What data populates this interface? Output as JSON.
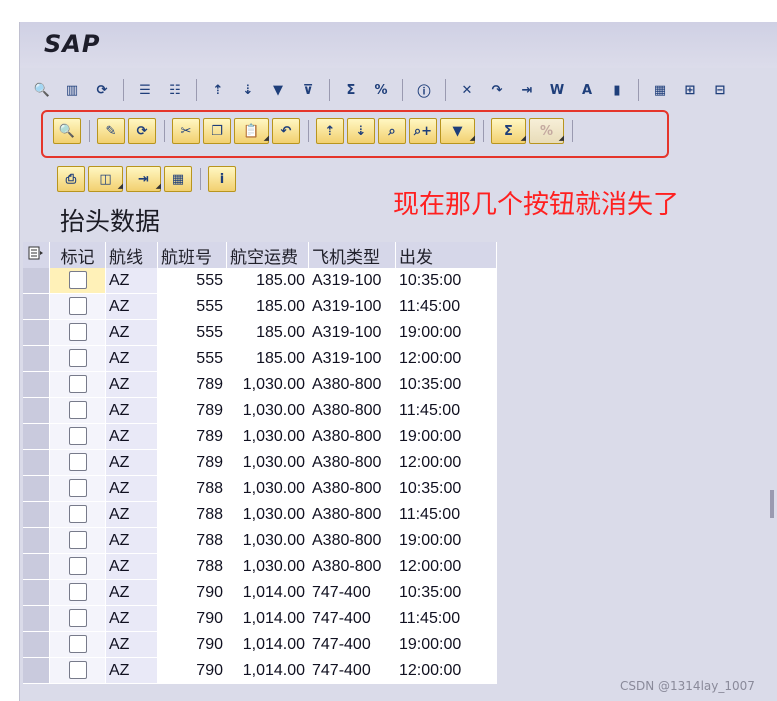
{
  "app": {
    "title": "SAP"
  },
  "toolbar_main": {
    "buttons": [
      {
        "icon": "detail-icon",
        "glyph": "🔍"
      },
      {
        "icon": "columns-icon",
        "glyph": "▥"
      },
      {
        "icon": "refresh-icon",
        "glyph": "⟳"
      },
      {
        "icon": "select-all-icon",
        "glyph": "☰"
      },
      {
        "icon": "deselect-icon",
        "glyph": "☷"
      },
      {
        "icon": "sort-asc-icon",
        "glyph": "⇡"
      },
      {
        "icon": "sort-desc-icon",
        "glyph": "⇣"
      },
      {
        "icon": "filter-icon",
        "glyph": "▼"
      },
      {
        "icon": "delete-filter-icon",
        "glyph": "⊽"
      },
      {
        "icon": "total-icon",
        "glyph": "Σ"
      },
      {
        "icon": "subtotal-icon",
        "glyph": "%"
      },
      {
        "icon": "info-icon",
        "glyph": "ⓘ"
      },
      {
        "icon": "export-excel-icon",
        "glyph": "✕"
      },
      {
        "icon": "transfer-icon",
        "glyph": "↷"
      },
      {
        "icon": "export-icon",
        "glyph": "⇥"
      },
      {
        "icon": "word-icon",
        "glyph": "W"
      },
      {
        "icon": "abc-analysis-icon",
        "glyph": "A"
      },
      {
        "icon": "graphic-icon",
        "glyph": "▮"
      },
      {
        "icon": "layout-icon",
        "glyph": "▦"
      },
      {
        "icon": "layout-select-icon",
        "glyph": "⊞"
      },
      {
        "icon": "layout-save-icon",
        "glyph": "⊟"
      }
    ]
  },
  "toolbar_app": {
    "groups": [
      [
        {
          "icon": "details-icon",
          "glyph": "🔍"
        }
      ],
      [
        {
          "icon": "change-icon",
          "glyph": "✎"
        },
        {
          "icon": "refresh-icon",
          "glyph": "⟳"
        }
      ],
      [
        {
          "icon": "cut-icon",
          "glyph": "✂"
        },
        {
          "icon": "copy-icon",
          "glyph": "❐"
        },
        {
          "icon": "paste-icon",
          "glyph": "📋",
          "drop": true
        },
        {
          "icon": "undo-icon",
          "glyph": "↶"
        }
      ],
      [
        {
          "icon": "sort-asc-icon",
          "glyph": "⇡"
        },
        {
          "icon": "sort-desc-icon",
          "glyph": "⇣"
        },
        {
          "icon": "find-icon",
          "glyph": "⌕"
        },
        {
          "icon": "find-next-icon",
          "glyph": "⌕+"
        },
        {
          "icon": "filter-icon",
          "glyph": "▼",
          "drop": true
        }
      ],
      [
        {
          "icon": "total-icon",
          "glyph": "Σ",
          "drop": true
        },
        {
          "icon": "subtotal-icon",
          "glyph": "%",
          "drop": true,
          "disabled": true
        }
      ]
    ]
  },
  "toolbar_third": {
    "buttons": [
      {
        "icon": "print-icon",
        "glyph": "⎙"
      },
      {
        "icon": "views-icon",
        "glyph": "◫",
        "drop": true
      },
      {
        "icon": "export-icon",
        "glyph": "⇥",
        "drop": true
      },
      {
        "icon": "layout-icon",
        "glyph": "▦"
      },
      {
        "icon": "info-icon",
        "glyph": "i"
      }
    ]
  },
  "annotation": "现在那几个按钮就消失了",
  "header_title": "抬头数据",
  "table": {
    "columns": [
      "标记",
      "航线",
      "航班号",
      "航空运费",
      "飞机类型",
      "出发"
    ],
    "rows": [
      [
        "AZ",
        "555",
        "185.00",
        "A319-100",
        "10:35:00"
      ],
      [
        "AZ",
        "555",
        "185.00",
        "A319-100",
        "11:45:00"
      ],
      [
        "AZ",
        "555",
        "185.00",
        "A319-100",
        "19:00:00"
      ],
      [
        "AZ",
        "555",
        "185.00",
        "A319-100",
        "12:00:00"
      ],
      [
        "AZ",
        "789",
        "1,030.00",
        "A380-800",
        "10:35:00"
      ],
      [
        "AZ",
        "789",
        "1,030.00",
        "A380-800",
        "11:45:00"
      ],
      [
        "AZ",
        "789",
        "1,030.00",
        "A380-800",
        "19:00:00"
      ],
      [
        "AZ",
        "789",
        "1,030.00",
        "A380-800",
        "12:00:00"
      ],
      [
        "AZ",
        "788",
        "1,030.00",
        "A380-800",
        "10:35:00"
      ],
      [
        "AZ",
        "788",
        "1,030.00",
        "A380-800",
        "11:45:00"
      ],
      [
        "AZ",
        "788",
        "1,030.00",
        "A380-800",
        "19:00:00"
      ],
      [
        "AZ",
        "788",
        "1,030.00",
        "A380-800",
        "12:00:00"
      ],
      [
        "AZ",
        "790",
        "1,014.00",
        "747-400",
        "10:35:00"
      ],
      [
        "AZ",
        "790",
        "1,014.00",
        "747-400",
        "11:45:00"
      ],
      [
        "AZ",
        "790",
        "1,014.00",
        "747-400",
        "19:00:00"
      ],
      [
        "AZ",
        "790",
        "1,014.00",
        "747-400",
        "12:00:00"
      ]
    ]
  },
  "footer": {
    "credit": "CSDN @1314lay_1007"
  },
  "colors": {
    "annotation": "#ff2020",
    "highlight_box": "#e5352b",
    "background": "#dadbe9"
  }
}
